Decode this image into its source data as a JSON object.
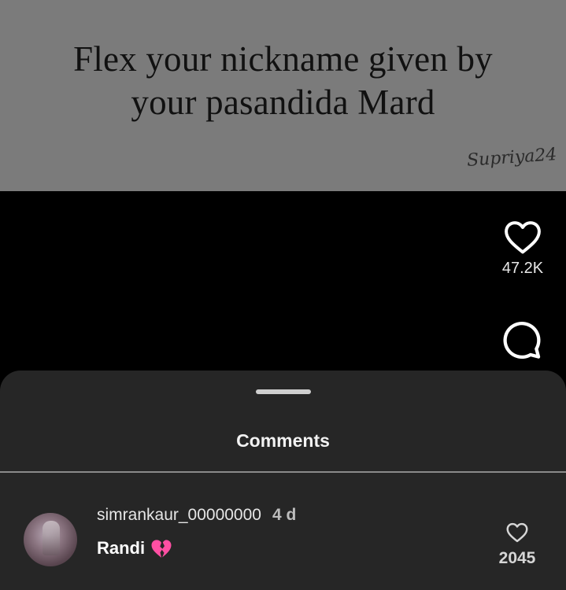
{
  "post": {
    "caption_line1": "Flex your nickname given by",
    "caption_line2": "your pasandida Mard",
    "watermark": "Supriya24",
    "background_color": "#7b7b7b"
  },
  "actions": {
    "like_icon": "heart-outline-icon",
    "like_count": "47.2K",
    "comment_icon": "speech-bubble-icon"
  },
  "comments_sheet": {
    "title": "Comments",
    "sheet_color": "#262626",
    "comments": [
      {
        "username": "simrankaur_00000000",
        "timestamp": "4 d",
        "text": "Randi",
        "emoji_icon": "broken-heart-icon",
        "emoji_color": "#ff4fa3",
        "like_count": "2045"
      }
    ]
  }
}
